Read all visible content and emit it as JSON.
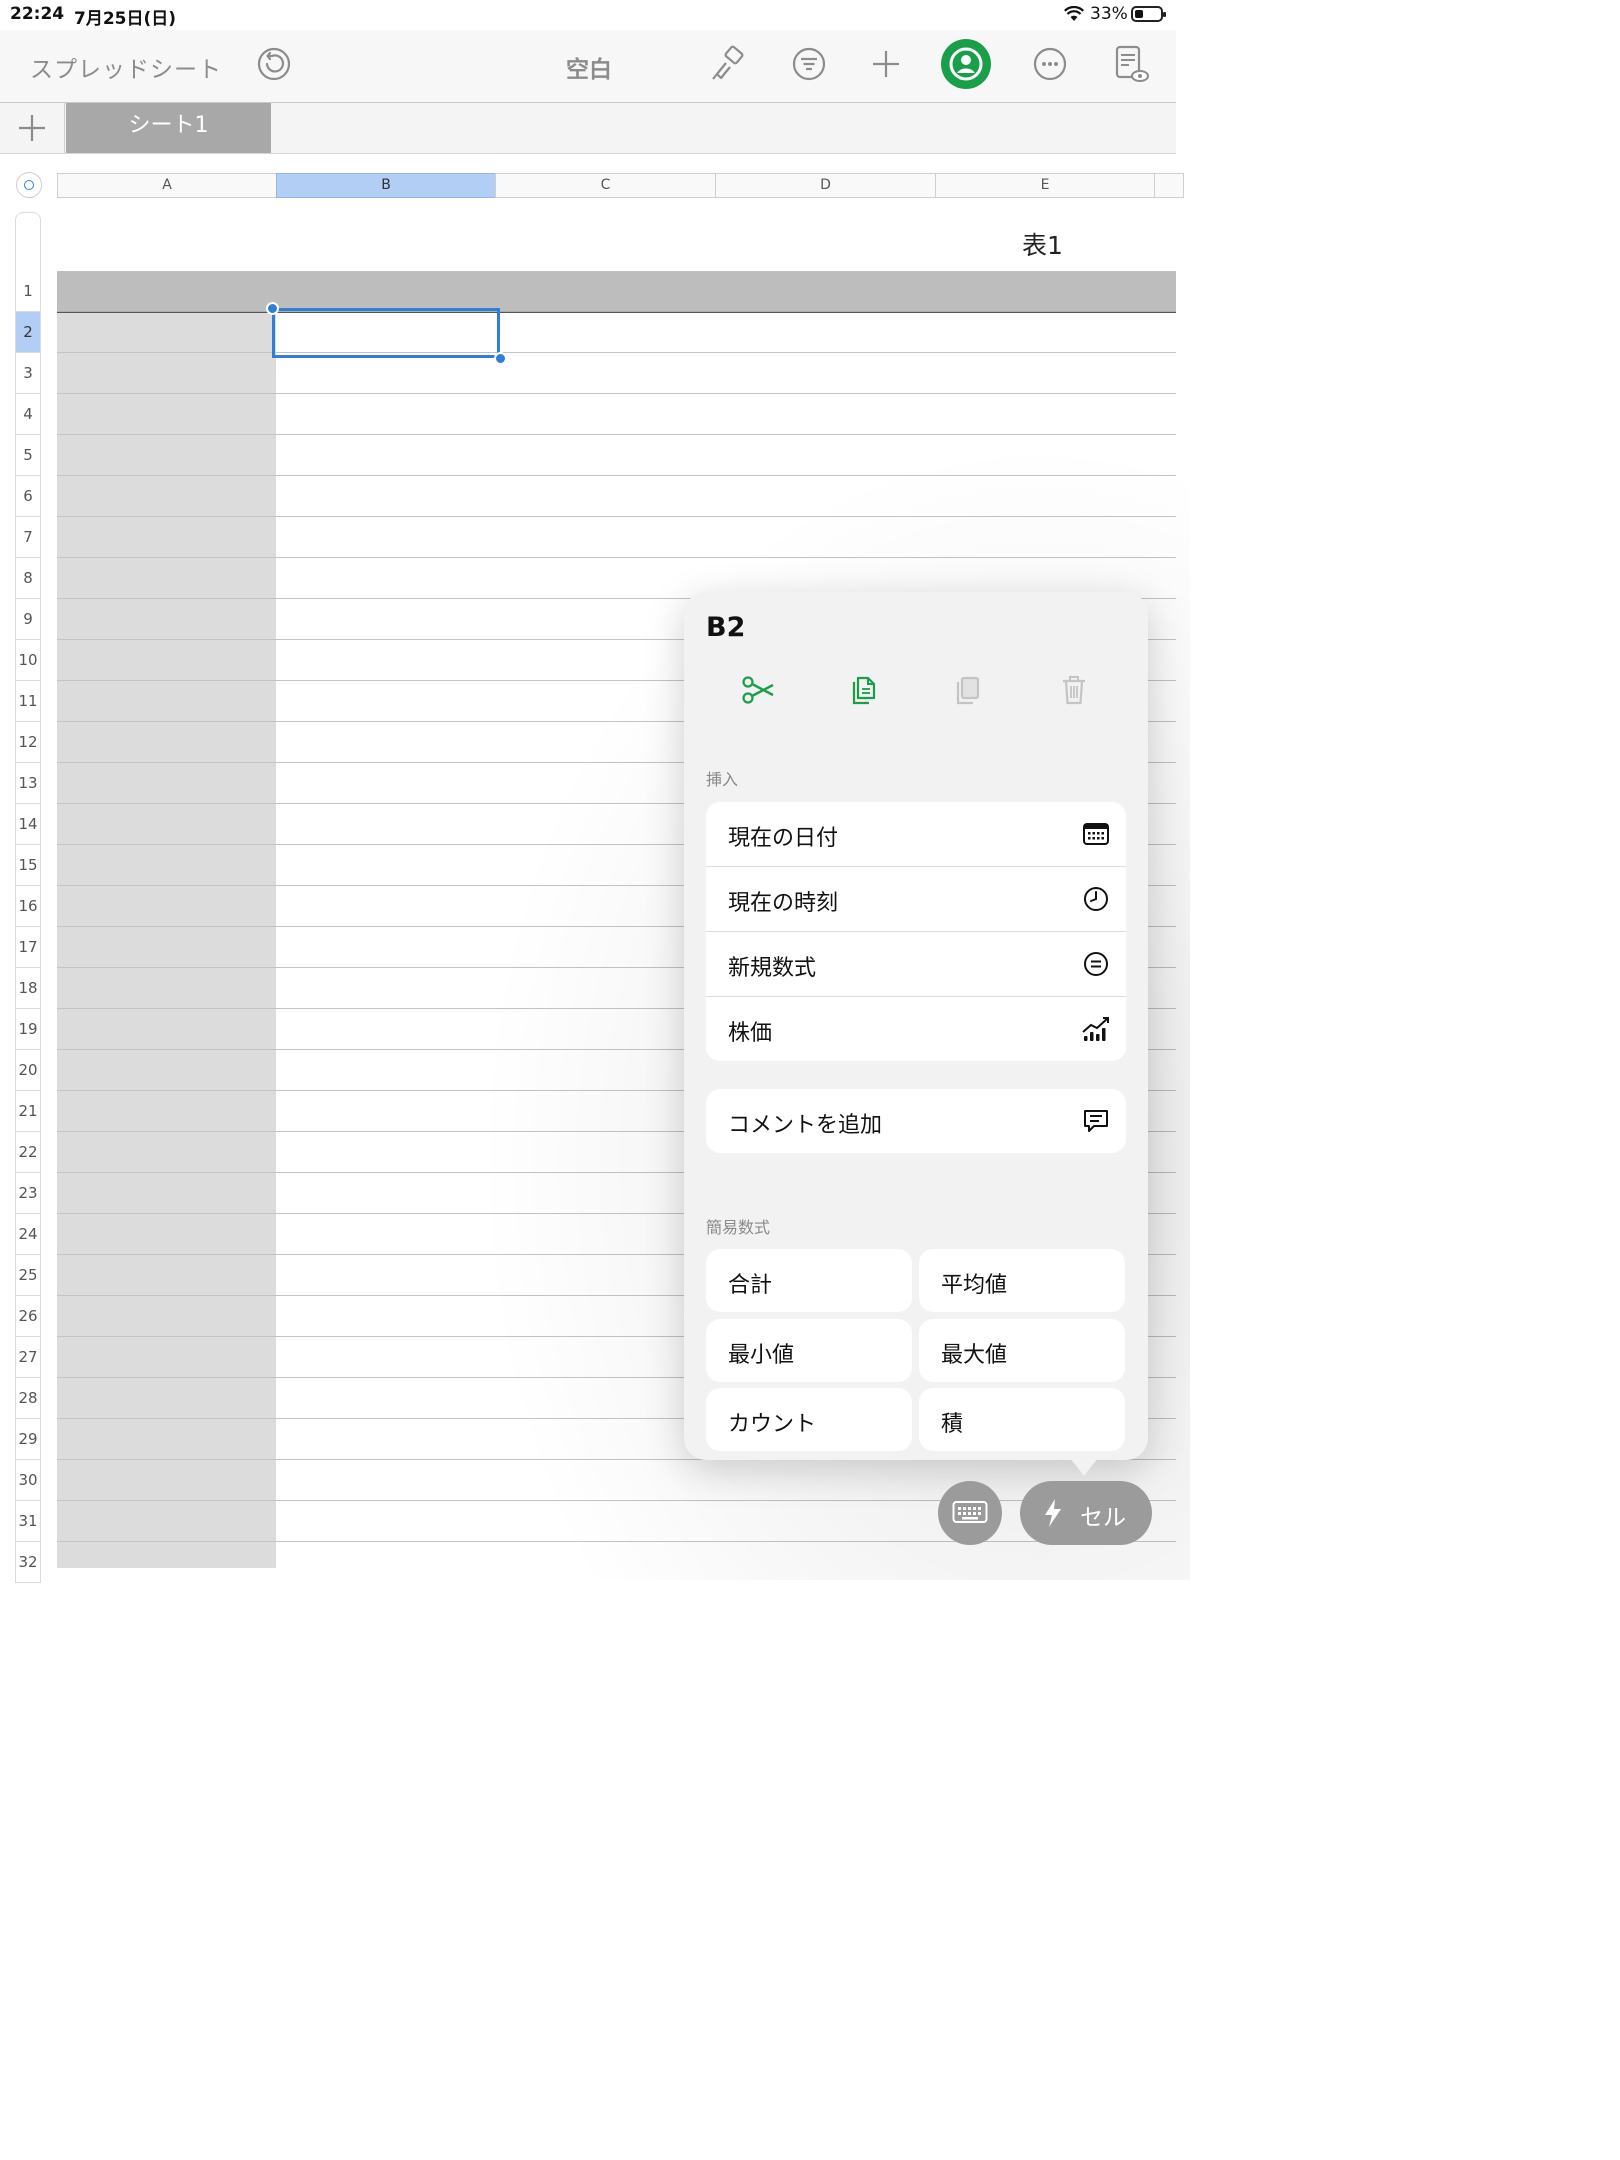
{
  "status": {
    "time": "22:24",
    "date": "7月25日(日)",
    "battery": "33%"
  },
  "toolbar": {
    "title": "スプレッドシート",
    "document": "空白"
  },
  "tabs": {
    "sheet": "シート1"
  },
  "columns": [
    "A",
    "B",
    "C",
    "D",
    "E"
  ],
  "rows": [
    "1",
    "2",
    "3",
    "4",
    "5",
    "6",
    "7",
    "8",
    "9",
    "10",
    "11",
    "12",
    "13",
    "14",
    "15",
    "16",
    "17",
    "18",
    "19",
    "20",
    "21",
    "22",
    "23",
    "24",
    "25",
    "26",
    "27",
    "28",
    "29",
    "30",
    "31",
    "32"
  ],
  "table": {
    "title": "表1",
    "selected_cell": "B2"
  },
  "popover": {
    "cell": "B2",
    "insert_label": "挿入",
    "insert_items": [
      {
        "label": "現在の日付",
        "icon": "calendar-icon"
      },
      {
        "label": "現在の時刻",
        "icon": "clock-icon"
      },
      {
        "label": "新規数式",
        "icon": "equals-icon"
      },
      {
        "label": "株価",
        "icon": "stock-chart-icon"
      }
    ],
    "comment": "コメントを追加",
    "quick_label": "簡易数式",
    "quick": [
      "合計",
      "平均値",
      "最小値",
      "最大値",
      "カウント",
      "積"
    ]
  },
  "bottom": {
    "cell_button": "セル"
  },
  "colors": {
    "accent": "#2f7fd6",
    "green": "#1a9e4a",
    "header_gray": "#bdbdbd"
  }
}
